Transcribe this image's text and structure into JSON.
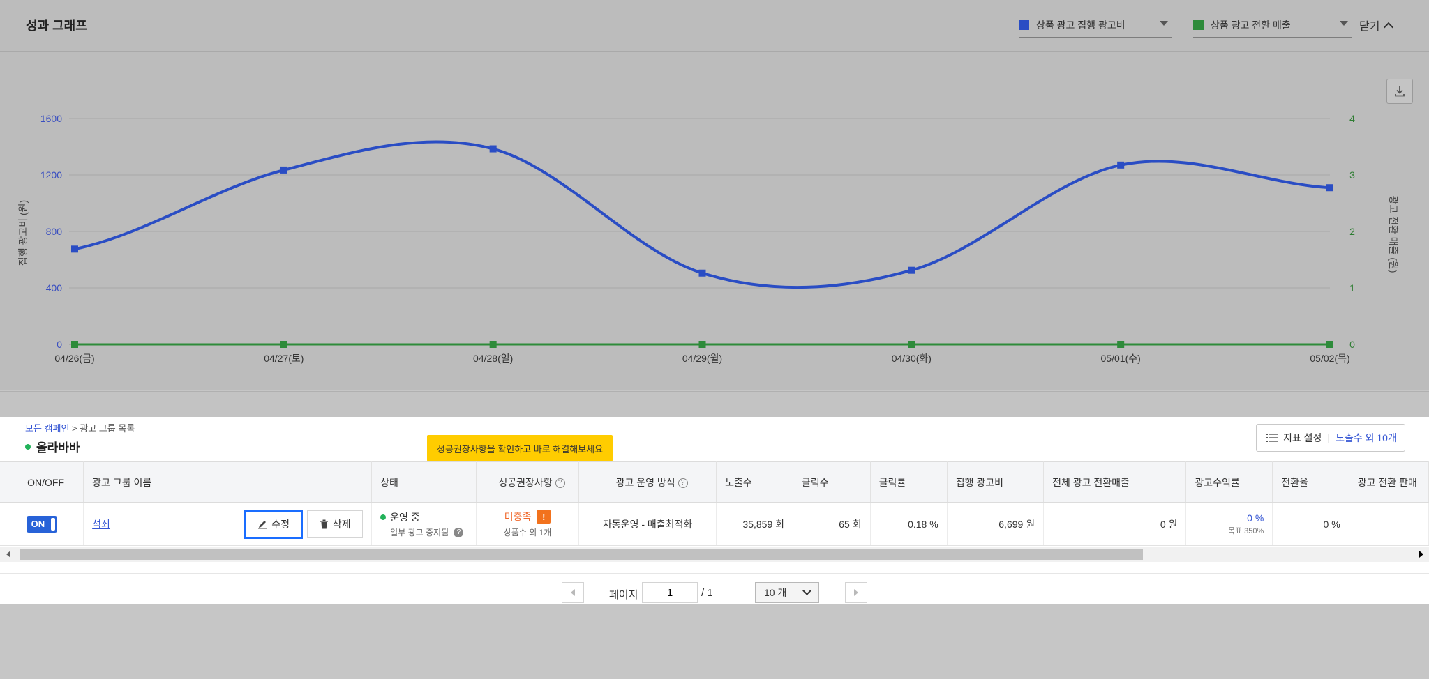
{
  "chart_panel": {
    "title": "성과 그래프",
    "series_select_1": "상품 광고 집행 광고비",
    "series_select_2": "상품 광고 전환 매출",
    "close_label": "닫기"
  },
  "chart_data": {
    "type": "line",
    "categories": [
      "04/26(금)",
      "04/27(토)",
      "04/28(일)",
      "04/29(월)",
      "04/30(화)",
      "05/01(수)",
      "05/02(목)"
    ],
    "series": [
      {
        "name": "상품 광고 집행 광고비",
        "axis": "left",
        "color": "#2a4dc4",
        "values": [
          675,
          1235,
          1385,
          505,
          525,
          1270,
          1110
        ]
      },
      {
        "name": "상품 광고 전환 매출",
        "axis": "right",
        "color": "#2e8b3a",
        "values": [
          0,
          0,
          0,
          0,
          0,
          0,
          0
        ]
      }
    ],
    "ylabel": "집행 광고비 (원)",
    "y2label": "광고 전환 매출 (원)",
    "yticks": [
      "0",
      "400",
      "800",
      "1200",
      "1600"
    ],
    "y2ticks": [
      "0",
      "1",
      "2",
      "3",
      "4"
    ],
    "ylim": [
      0,
      1600
    ],
    "y2lim": [
      0,
      4
    ],
    "grid": true
  },
  "list_panel": {
    "breadcrumb_root": "모든 캠페인",
    "breadcrumb_sep": ">",
    "breadcrumb_current": "광고 그룹 목록",
    "group_name": "올라바바",
    "tooltip": "성공권장사항을 확인하고 바로 해결해보세요",
    "metric_settings": "지표 설정",
    "metric_summary": "노출수 외 10개",
    "columns": [
      "ON/OFF",
      "광고 그룹 이름",
      "상태",
      "성공권장사항",
      "광고 운영 방식",
      "노출수",
      "클릭수",
      "클릭률",
      "집행 광고비",
      "전체 광고 전환매출",
      "광고수익률",
      "전환율",
      "광고 전환 판매"
    ],
    "row": {
      "toggle": "ON",
      "name": "석쇠",
      "edit": "수정",
      "delete": "삭제",
      "status": "운영 중",
      "status_sub": "일부 광고 중지됨",
      "rec": "미충족",
      "rec_badge": "!",
      "rec_sub": "상품수 외 1개",
      "operation": "자동운영 - 매출최적화",
      "impressions": "35,859 회",
      "clicks": "65 회",
      "ctr": "0.18 %",
      "spend": "6,699 원",
      "total_revenue": "0 원",
      "roas": "0 %",
      "roas_target": "목표 350%",
      "cvr": "0 %",
      "sales": ""
    },
    "pager": {
      "label": "페이지",
      "current": "1",
      "total": "/ 1",
      "size": "10 개"
    }
  }
}
